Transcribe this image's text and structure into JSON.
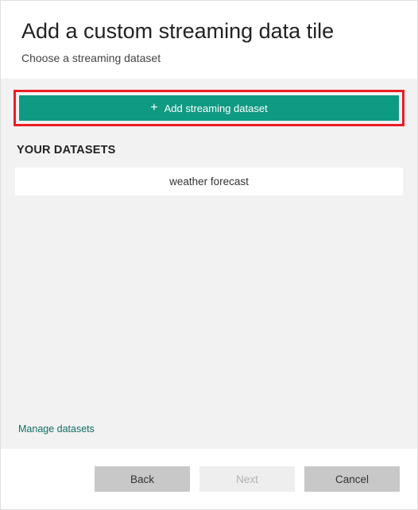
{
  "header": {
    "title": "Add a custom streaming data tile",
    "subtitle": "Choose a streaming dataset"
  },
  "addButton": {
    "icon": "+",
    "label": "Add streaming dataset"
  },
  "datasets": {
    "sectionLabel": "YOUR DATASETS",
    "items": [
      {
        "name": "weather forecast"
      }
    ]
  },
  "manageLink": "Manage datasets",
  "footer": {
    "back": "Back",
    "next": "Next",
    "cancel": "Cancel"
  },
  "colors": {
    "accent": "#0f9a83",
    "highlight": "#ec1c24",
    "bodyBg": "#f2f2f2"
  }
}
